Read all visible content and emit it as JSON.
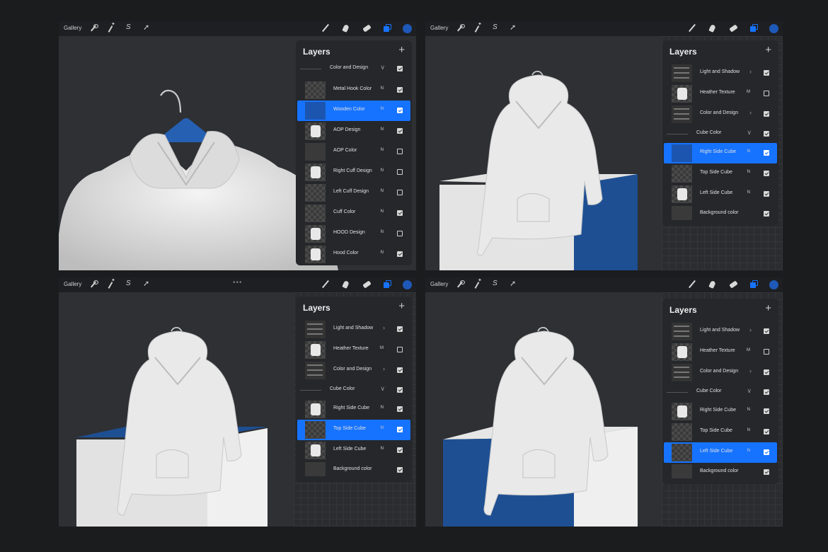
{
  "screens": [
    {
      "gallery": "Gallery",
      "layers_title": "Layers",
      "add_symbol": "+",
      "rows": [
        {
          "label": "Color and Design",
          "mode": "",
          "group": true,
          "expanded": true,
          "checked": true,
          "selected": false,
          "thumb": "group"
        },
        {
          "label": "Metal Hook Color",
          "mode": "N",
          "group": false,
          "checked": true,
          "selected": false,
          "thumb": "checker"
        },
        {
          "label": "Wooden Color",
          "mode": "N",
          "group": false,
          "checked": true,
          "selected": true,
          "thumb": "blue"
        },
        {
          "label": "AOP Design",
          "mode": "N",
          "group": false,
          "checked": true,
          "selected": false,
          "thumb": "white"
        },
        {
          "label": "AOP Color",
          "mode": "N",
          "group": false,
          "checked": false,
          "selected": false,
          "thumb": "plain"
        },
        {
          "label": "Right Cuff Design",
          "mode": "N",
          "group": false,
          "checked": false,
          "selected": false,
          "thumb": "white"
        },
        {
          "label": "Left Cuff Design",
          "mode": "N",
          "group": false,
          "checked": false,
          "selected": false,
          "thumb": "checker"
        },
        {
          "label": "Cuff Color",
          "mode": "N",
          "group": false,
          "checked": true,
          "selected": false,
          "thumb": "checker"
        },
        {
          "label": "HOOD Design",
          "mode": "N",
          "group": false,
          "checked": false,
          "selected": false,
          "thumb": "white"
        },
        {
          "label": "Hood Color",
          "mode": "N",
          "group": false,
          "checked": true,
          "selected": false,
          "thumb": "white"
        }
      ]
    },
    {
      "gallery": "Gallery",
      "layers_title": "Layers",
      "add_symbol": "+",
      "rows": [
        {
          "label": "Light and Shadow",
          "mode": "",
          "group": true,
          "expanded": false,
          "checked": true,
          "selected": false,
          "thumb": "group"
        },
        {
          "label": "Heather Texture",
          "mode": "M",
          "group": false,
          "checked": false,
          "selected": false,
          "thumb": "white"
        },
        {
          "label": "Color and Design",
          "mode": "",
          "group": true,
          "expanded": false,
          "checked": true,
          "selected": false,
          "thumb": "group"
        },
        {
          "label": "Cube Color",
          "mode": "",
          "group": true,
          "expanded": true,
          "checked": true,
          "selected": false,
          "thumb": "none"
        },
        {
          "label": "Right Side Cube",
          "mode": "N",
          "group": false,
          "checked": true,
          "selected": true,
          "thumb": "blue"
        },
        {
          "label": "Top Side Cube",
          "mode": "N",
          "group": false,
          "checked": true,
          "selected": false,
          "thumb": "checker"
        },
        {
          "label": "Left Side Cube",
          "mode": "N",
          "group": false,
          "checked": true,
          "selected": false,
          "thumb": "white"
        },
        {
          "label": "Background color",
          "mode": "",
          "group": false,
          "checked": true,
          "selected": false,
          "thumb": "plain"
        }
      ]
    },
    {
      "gallery": "Gallery",
      "layers_title": "Layers",
      "add_symbol": "+",
      "rows": [
        {
          "label": "Light and Shadow",
          "mode": "",
          "group": true,
          "expanded": false,
          "checked": true,
          "selected": false,
          "thumb": "group"
        },
        {
          "label": "Heather Texture",
          "mode": "M",
          "group": false,
          "checked": false,
          "selected": false,
          "thumb": "white"
        },
        {
          "label": "Color and Design",
          "mode": "",
          "group": true,
          "expanded": false,
          "checked": true,
          "selected": false,
          "thumb": "group"
        },
        {
          "label": "Cube Color",
          "mode": "",
          "group": true,
          "expanded": true,
          "checked": true,
          "selected": false,
          "thumb": "none"
        },
        {
          "label": "Right Side Cube",
          "mode": "N",
          "group": false,
          "checked": true,
          "selected": false,
          "thumb": "white"
        },
        {
          "label": "Top Side Cube",
          "mode": "N",
          "group": false,
          "checked": true,
          "selected": true,
          "thumb": "checker"
        },
        {
          "label": "Left Side Cube",
          "mode": "N",
          "group": false,
          "checked": true,
          "selected": false,
          "thumb": "white"
        },
        {
          "label": "Background color",
          "mode": "",
          "group": false,
          "checked": true,
          "selected": false,
          "thumb": "plain"
        }
      ]
    },
    {
      "gallery": "Gallery",
      "layers_title": "Layers",
      "add_symbol": "+",
      "rows": [
        {
          "label": "Light and Shadow",
          "mode": "",
          "group": true,
          "expanded": false,
          "checked": true,
          "selected": false,
          "thumb": "group"
        },
        {
          "label": "Heather Texture",
          "mode": "M",
          "group": false,
          "checked": false,
          "selected": false,
          "thumb": "white"
        },
        {
          "label": "Color and Design",
          "mode": "",
          "group": true,
          "expanded": false,
          "checked": true,
          "selected": false,
          "thumb": "group"
        },
        {
          "label": "Cube Color",
          "mode": "",
          "group": true,
          "expanded": true,
          "checked": true,
          "selected": false,
          "thumb": "none"
        },
        {
          "label": "Right Side Cube",
          "mode": "N",
          "group": false,
          "checked": true,
          "selected": false,
          "thumb": "white"
        },
        {
          "label": "Top Side Cube",
          "mode": "N",
          "group": false,
          "checked": true,
          "selected": false,
          "thumb": "checker"
        },
        {
          "label": "Left Side Cube",
          "mode": "N",
          "group": false,
          "checked": true,
          "selected": true,
          "thumb": "checker"
        },
        {
          "label": "Background color",
          "mode": "",
          "group": false,
          "checked": true,
          "selected": false,
          "thumb": "plain"
        }
      ]
    }
  ],
  "icons": {
    "left_tools": [
      "wrench-icon",
      "magic-wand-icon",
      "selection-icon",
      "transform-arrow-icon"
    ],
    "right_tools": [
      "brush-icon",
      "smudge-icon",
      "eraser-icon",
      "layers-icon",
      "color-icon"
    ]
  },
  "colors": {
    "accent": "#1673ff",
    "cube_blue": "#1e4f93",
    "hanger_blue": "#2660b3",
    "hoodie": "#e8e8e8",
    "background": "#1b1c1e",
    "panel": "#25272b"
  }
}
